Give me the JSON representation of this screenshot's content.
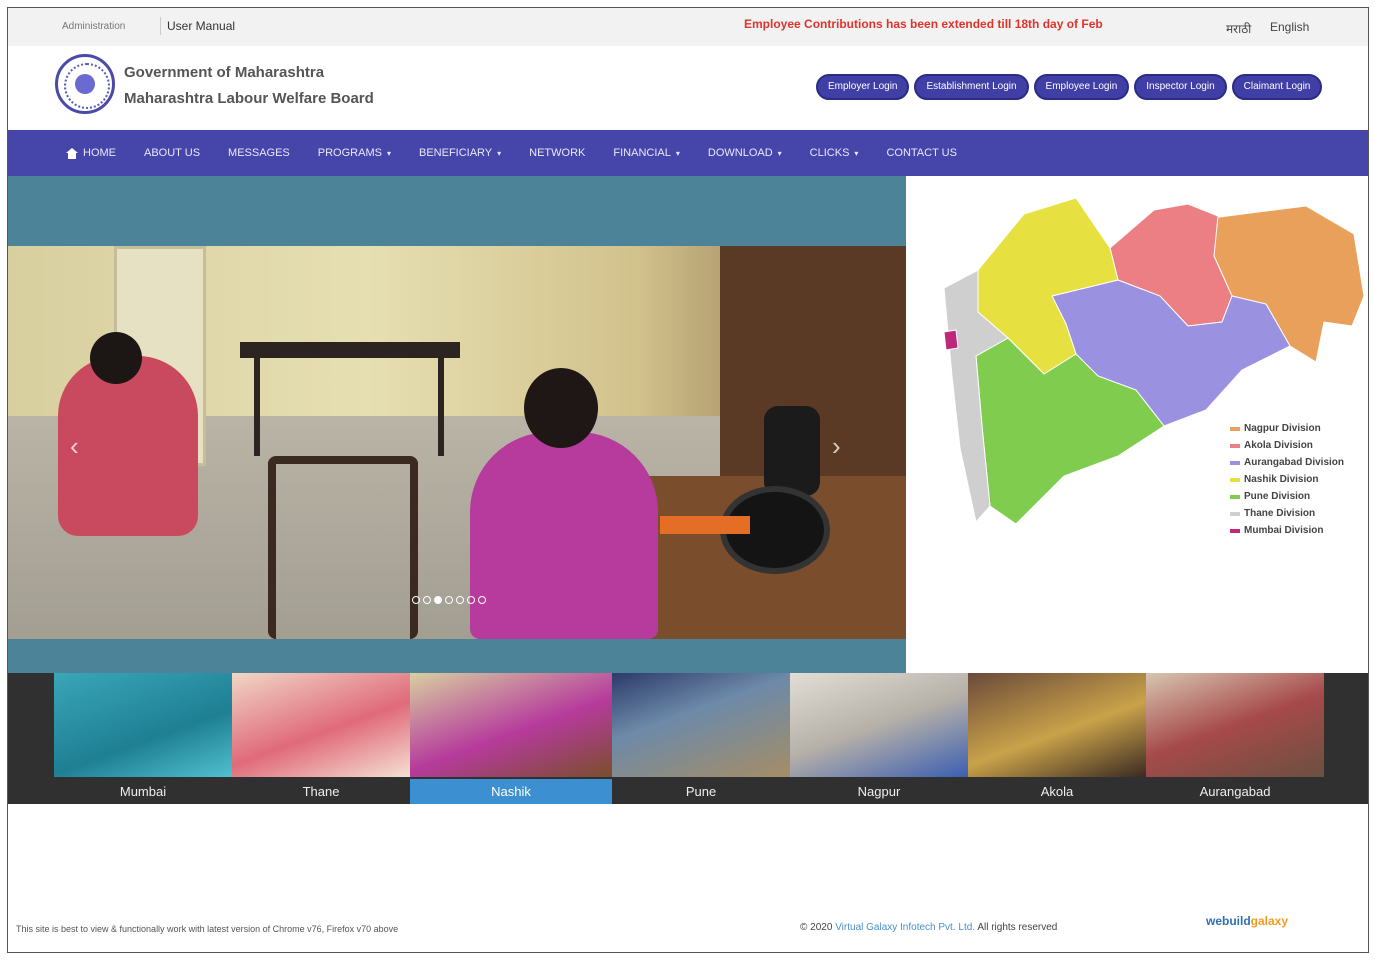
{
  "topbar": {
    "administration": "Administration",
    "user_manual": "User Manual",
    "notice": "Employee Contributions has been extended till 18th day of Feb",
    "lang_marathi": "मराठी",
    "lang_english": "English"
  },
  "header": {
    "org_line1": "Government of Maharashtra",
    "org_line2": "Maharashtra Labour Welfare Board",
    "logins": [
      "Employer Login",
      "Establishment Login",
      "Employee Login",
      "Inspector Login",
      "Claimant Login"
    ]
  },
  "nav": {
    "items": [
      {
        "label": "HOME",
        "icon": "home-icon",
        "dropdown": false
      },
      {
        "label": "ABOUT US",
        "dropdown": false
      },
      {
        "label": "MESSAGES",
        "dropdown": false
      },
      {
        "label": "PROGRAMS",
        "dropdown": true
      },
      {
        "label": "BENEFICIARY",
        "dropdown": true
      },
      {
        "label": "NETWORK",
        "dropdown": false
      },
      {
        "label": "FINANCIAL",
        "dropdown": true
      },
      {
        "label": "DOWNLOAD",
        "dropdown": true
      },
      {
        "label": "CLICKS",
        "dropdown": true
      },
      {
        "label": "CONTACT US",
        "dropdown": false
      }
    ],
    "caret": "▾"
  },
  "slider": {
    "prev_glyph": "‹",
    "next_glyph": "›",
    "dot_count": 7,
    "active_dot": 2
  },
  "map": {
    "legend": [
      {
        "label": "Nagpur Division",
        "color": "#e8a05a"
      },
      {
        "label": "Akola Division",
        "color": "#ec7f84"
      },
      {
        "label": "Aurangabad Division",
        "color": "#9a92e0"
      },
      {
        "label": "Nashik Division",
        "color": "#e6e040"
      },
      {
        "label": "Pune Division",
        "color": "#7fcc4e"
      },
      {
        "label": "Thane Division",
        "color": "#cfcfcf"
      },
      {
        "label": "Mumbai Division",
        "color": "#c0287a"
      }
    ]
  },
  "thumbnails": [
    {
      "caption": "Mumbai",
      "active": false
    },
    {
      "caption": "Thane",
      "active": false
    },
    {
      "caption": "Nashik",
      "active": true
    },
    {
      "caption": "Pune",
      "active": false
    },
    {
      "caption": "Nagpur",
      "active": false
    },
    {
      "caption": "Akola",
      "active": false
    },
    {
      "caption": "Aurangabad",
      "active": false
    }
  ],
  "footer": {
    "browser_note": "This site is best to view & functionally work with latest version of Chrome v76, Firefox v70 above",
    "copyright_prefix": "© 2020",
    "copyright_company": "Virtual Galaxy Infotech Pvt. Ltd.",
    "copyright_suffix": "All rights reserved",
    "brand_main": "webuild",
    "brand_accent": "galaxy"
  }
}
